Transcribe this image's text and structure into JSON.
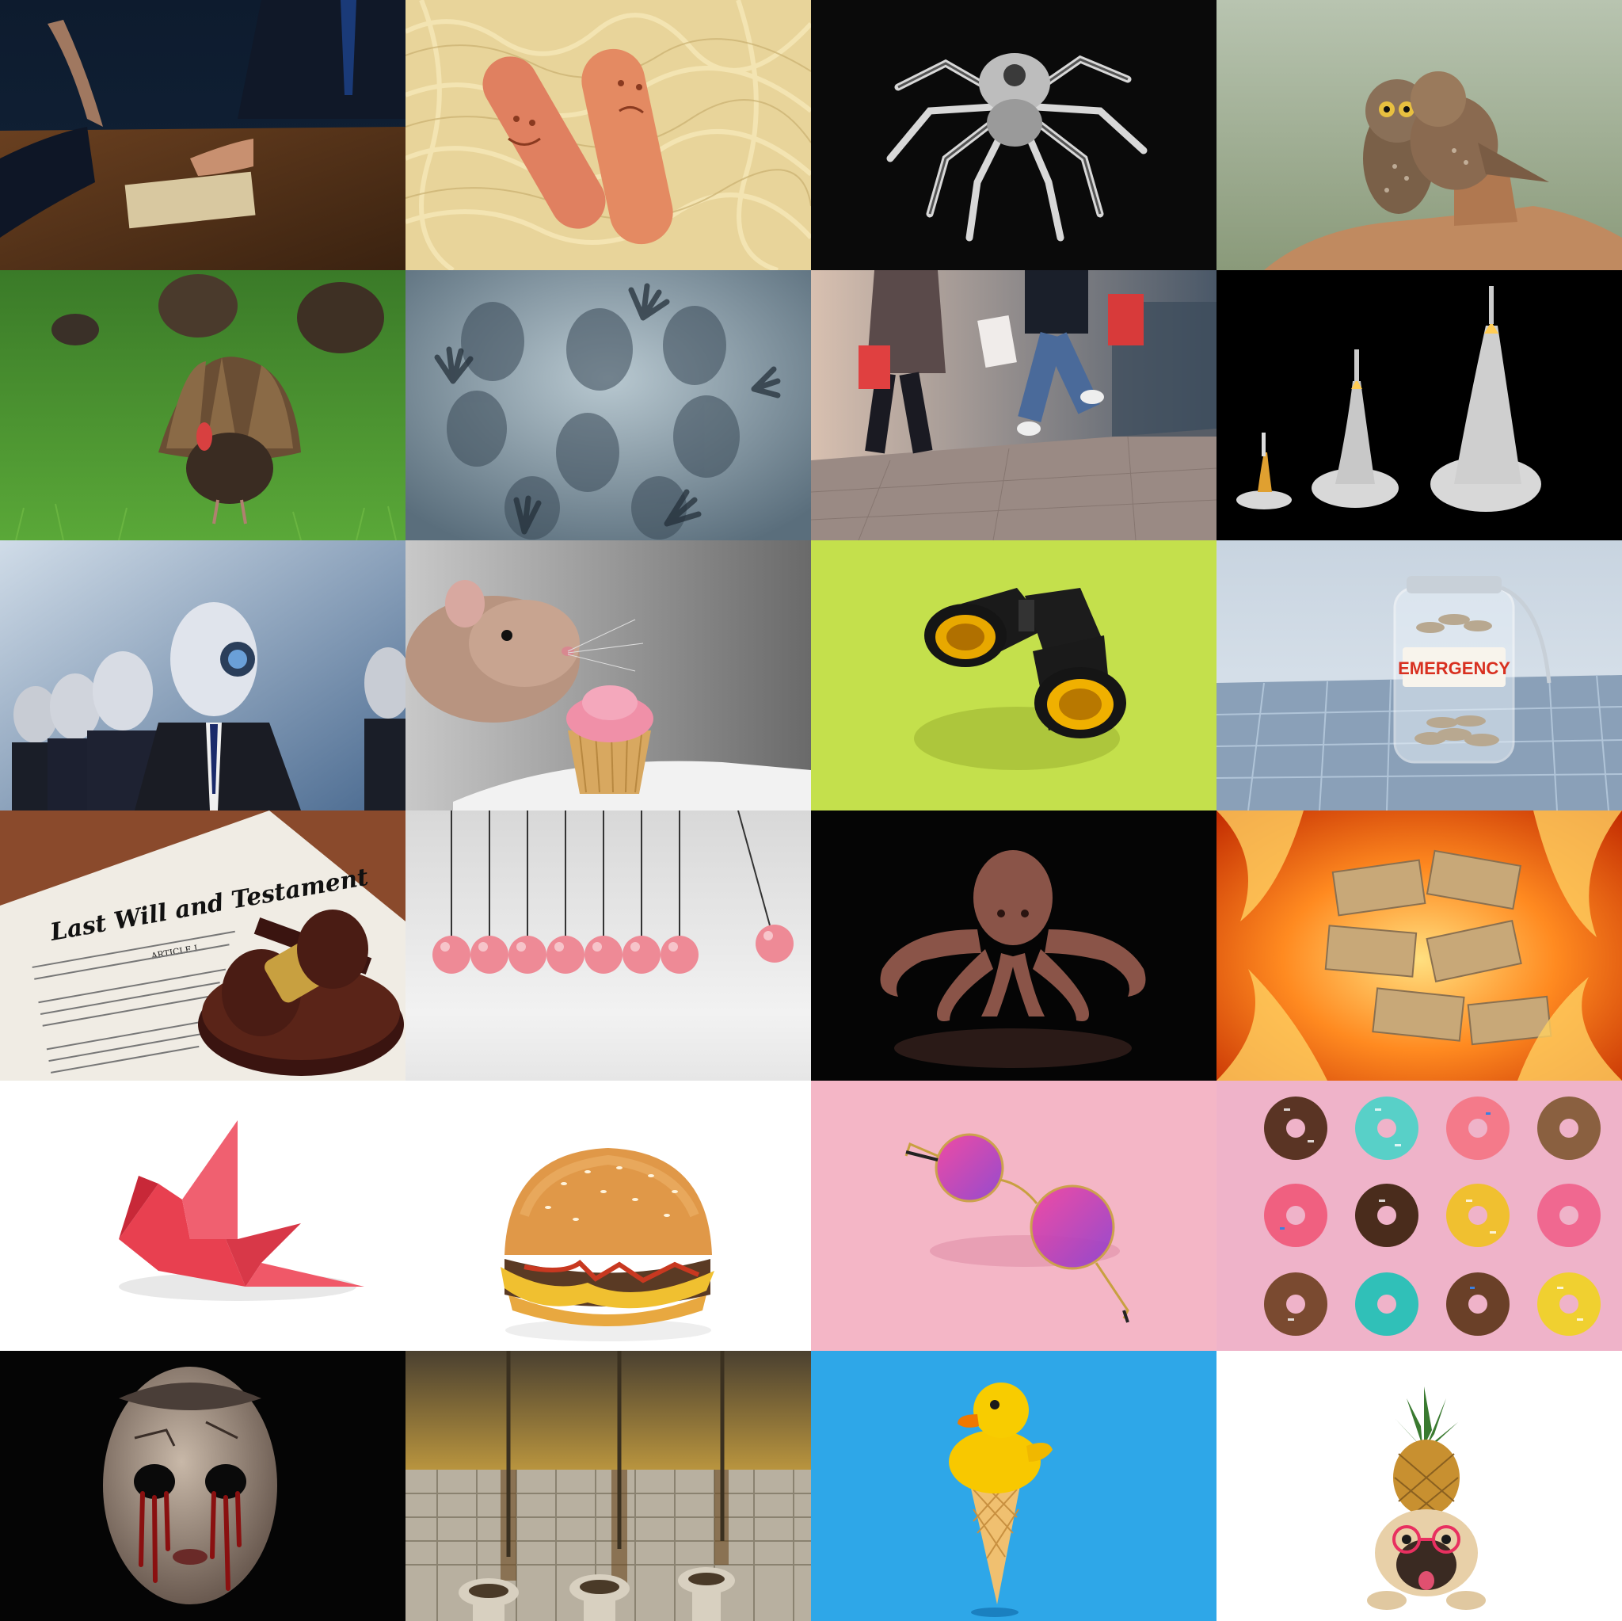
{
  "tiles": [
    {
      "id": "bribe-envelope"
    },
    {
      "id": "sausage-spaghetti"
    },
    {
      "id": "tarantula"
    },
    {
      "id": "owls-kissing"
    },
    {
      "id": "turkeys-grass"
    },
    {
      "id": "ghost-hands-glass"
    },
    {
      "id": "shopping-jump"
    },
    {
      "id": "rocket-launch"
    },
    {
      "id": "robot-businessmen"
    },
    {
      "id": "rat-cupcake"
    },
    {
      "id": "binoculars"
    },
    {
      "id": "emergency-jar"
    },
    {
      "id": "will-gavel"
    },
    {
      "id": "newton-cradle"
    },
    {
      "id": "octopus"
    },
    {
      "id": "money-fire"
    },
    {
      "id": "origami-crane"
    },
    {
      "id": "hamburger"
    },
    {
      "id": "pink-sunglasses"
    },
    {
      "id": "donuts"
    },
    {
      "id": "doll-head"
    },
    {
      "id": "dirty-toilets"
    },
    {
      "id": "duck-ice-cream"
    },
    {
      "id": "pug-pineapple"
    }
  ],
  "jar_label": "EMERGENCY",
  "document": {
    "title": "Last Will and Testament",
    "heading": "ARTICLE I"
  },
  "colors": {
    "lime": "#c4e04c",
    "sky": "#2ea7e8",
    "pink": "#f4b6c6",
    "donut_bg": "#efb3c9"
  }
}
